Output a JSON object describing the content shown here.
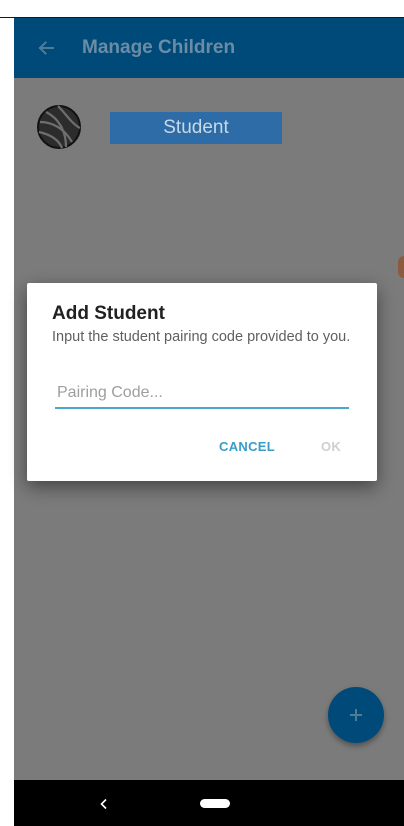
{
  "appbar": {
    "title": "Manage Children",
    "back_icon": "arrow-left-icon"
  },
  "children": [
    {
      "name": "Student",
      "avatar_icon": "volleyball-icon"
    }
  ],
  "dialog": {
    "title": "Add Student",
    "message": "Input the student pairing code provided to you.",
    "input_value": "",
    "input_placeholder": "Pairing Code...",
    "cancel_label": "CANCEL",
    "ok_label": "OK"
  },
  "fab": {
    "icon": "plus-icon"
  },
  "navbar": {
    "back_icon": "chevron-left-icon",
    "home_icon": "home-pill-icon"
  },
  "colors": {
    "appbar": "#004a79",
    "scrim": "#7b7b7b",
    "chip": "#2e6ca8",
    "accent": "#3a9cc9",
    "disabled": "#cfcfcf",
    "navbar": "#000000"
  }
}
